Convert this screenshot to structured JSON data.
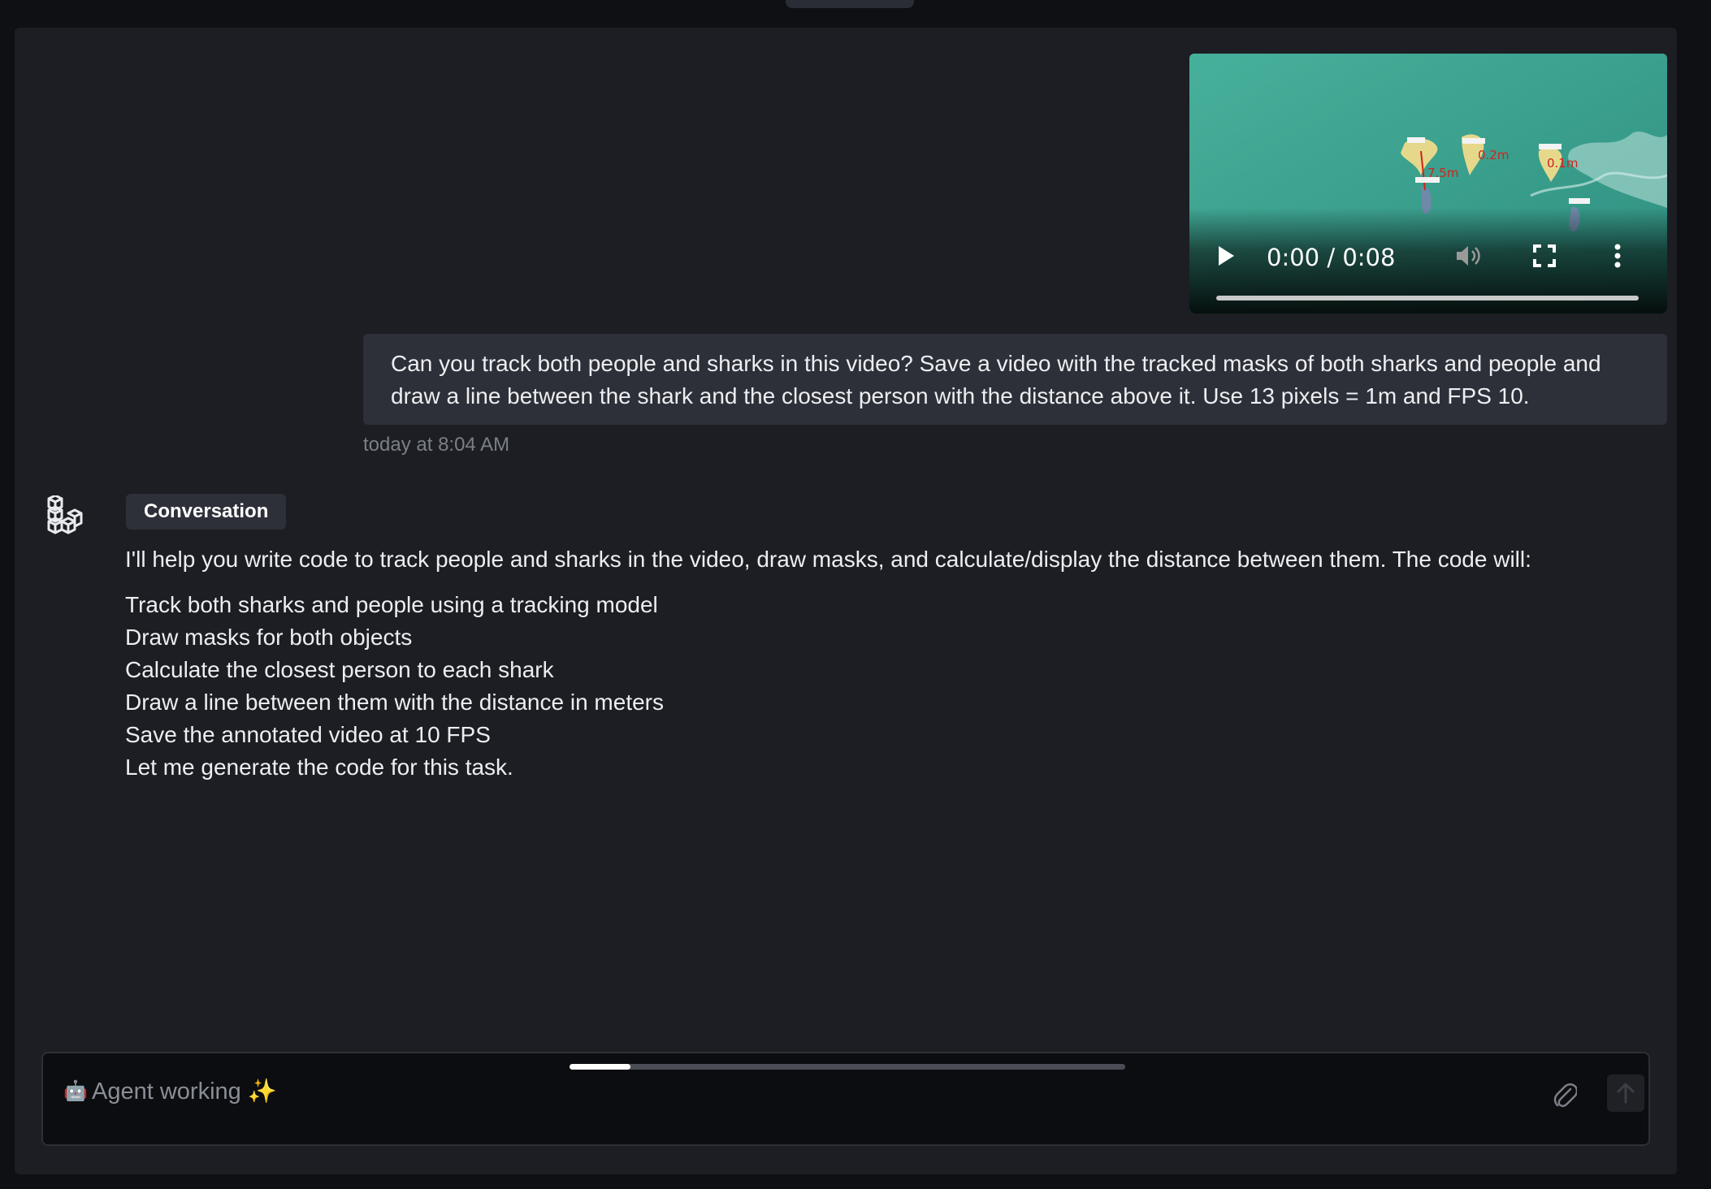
{
  "video": {
    "time": "0:00 / 0:08",
    "progress": 0,
    "annotations": {
      "distances": [
        "7.5m",
        "0.2m",
        "0.1m"
      ],
      "labels": [
        "1: shark",
        "3: shark",
        "2: shark",
        "1: person",
        "1: person"
      ]
    }
  },
  "user_message": {
    "text": "Can you track both people and sharks in this video? Save a video with the tracked masks of both sharks and people and draw a line between the shark and the closest person with the distance above it. Use 13 pixels = 1m and FPS 10.",
    "timestamp": "today at 8:04 AM"
  },
  "assistant": {
    "badge": "Conversation",
    "intro": "I'll help you write code to track people and sharks in the video, draw masks, and calculate/display the distance between them. The code will:",
    "items": [
      "Track both sharks and people using a tracking model",
      "Draw masks for both objects",
      "Calculate the closest person to each shark",
      "Draw a line between them with the distance in meters",
      "Save the annotated video at 10 FPS",
      "Let me generate the code for this task."
    ]
  },
  "input": {
    "robot_glyph": "🤖",
    "placeholder": "Agent working ✨",
    "progress_fraction": 0.11
  },
  "icons": {
    "play": "play-icon",
    "volume": "volume-icon",
    "fullscreen": "fullscreen-icon",
    "more": "more-vertical-icon",
    "avatar": "stacked-cubes-icon",
    "attach": "paperclip-icon",
    "send": "arrow-up-icon"
  }
}
